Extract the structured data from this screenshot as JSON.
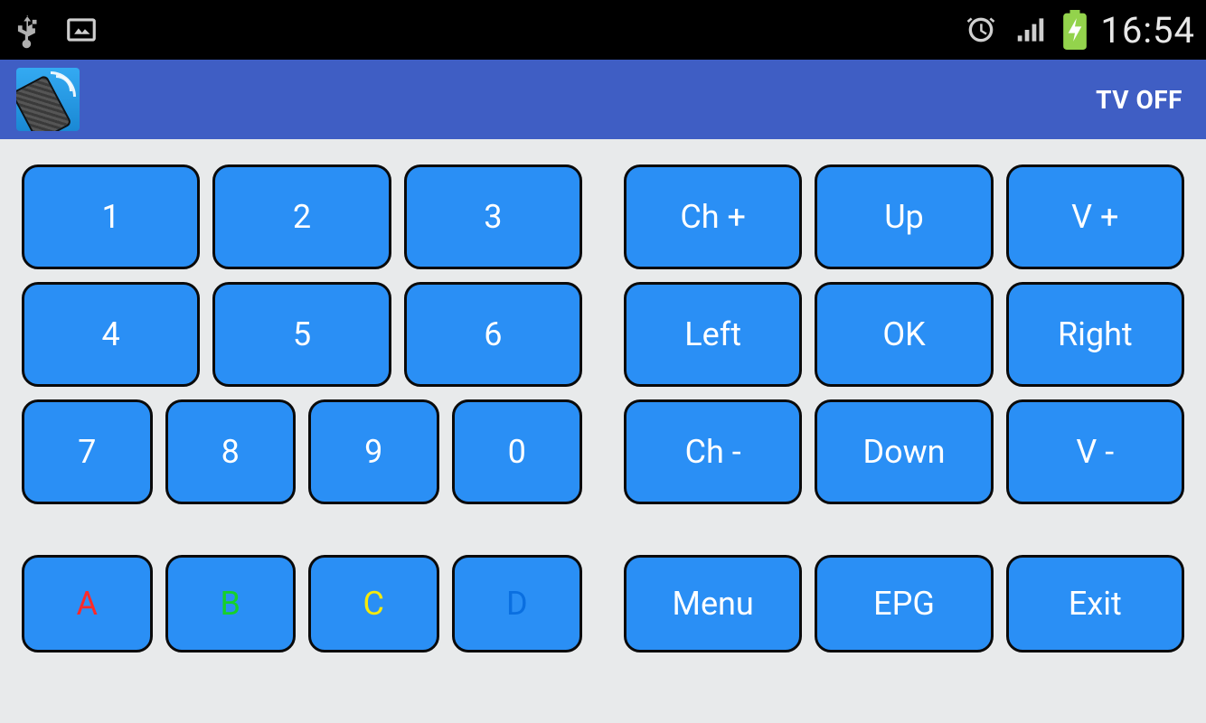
{
  "status": {
    "time": "16:54"
  },
  "appbar": {
    "tv_off_label": "TV OFF"
  },
  "numpad": {
    "n1": "1",
    "n2": "2",
    "n3": "3",
    "n4": "4",
    "n5": "5",
    "n6": "6",
    "n7": "7",
    "n8": "8",
    "n9": "9",
    "n0": "0"
  },
  "nav": {
    "ch_up": "Ch +",
    "up": "Up",
    "v_up": "V +",
    "left": "Left",
    "ok": "OK",
    "right": "Right",
    "ch_down": "Ch -",
    "down": "Down",
    "v_down": "V -"
  },
  "colors": {
    "a": "A",
    "b": "B",
    "c": "C",
    "d": "D"
  },
  "menu": {
    "menu": "Menu",
    "epg": "EPG",
    "exit": "Exit"
  }
}
